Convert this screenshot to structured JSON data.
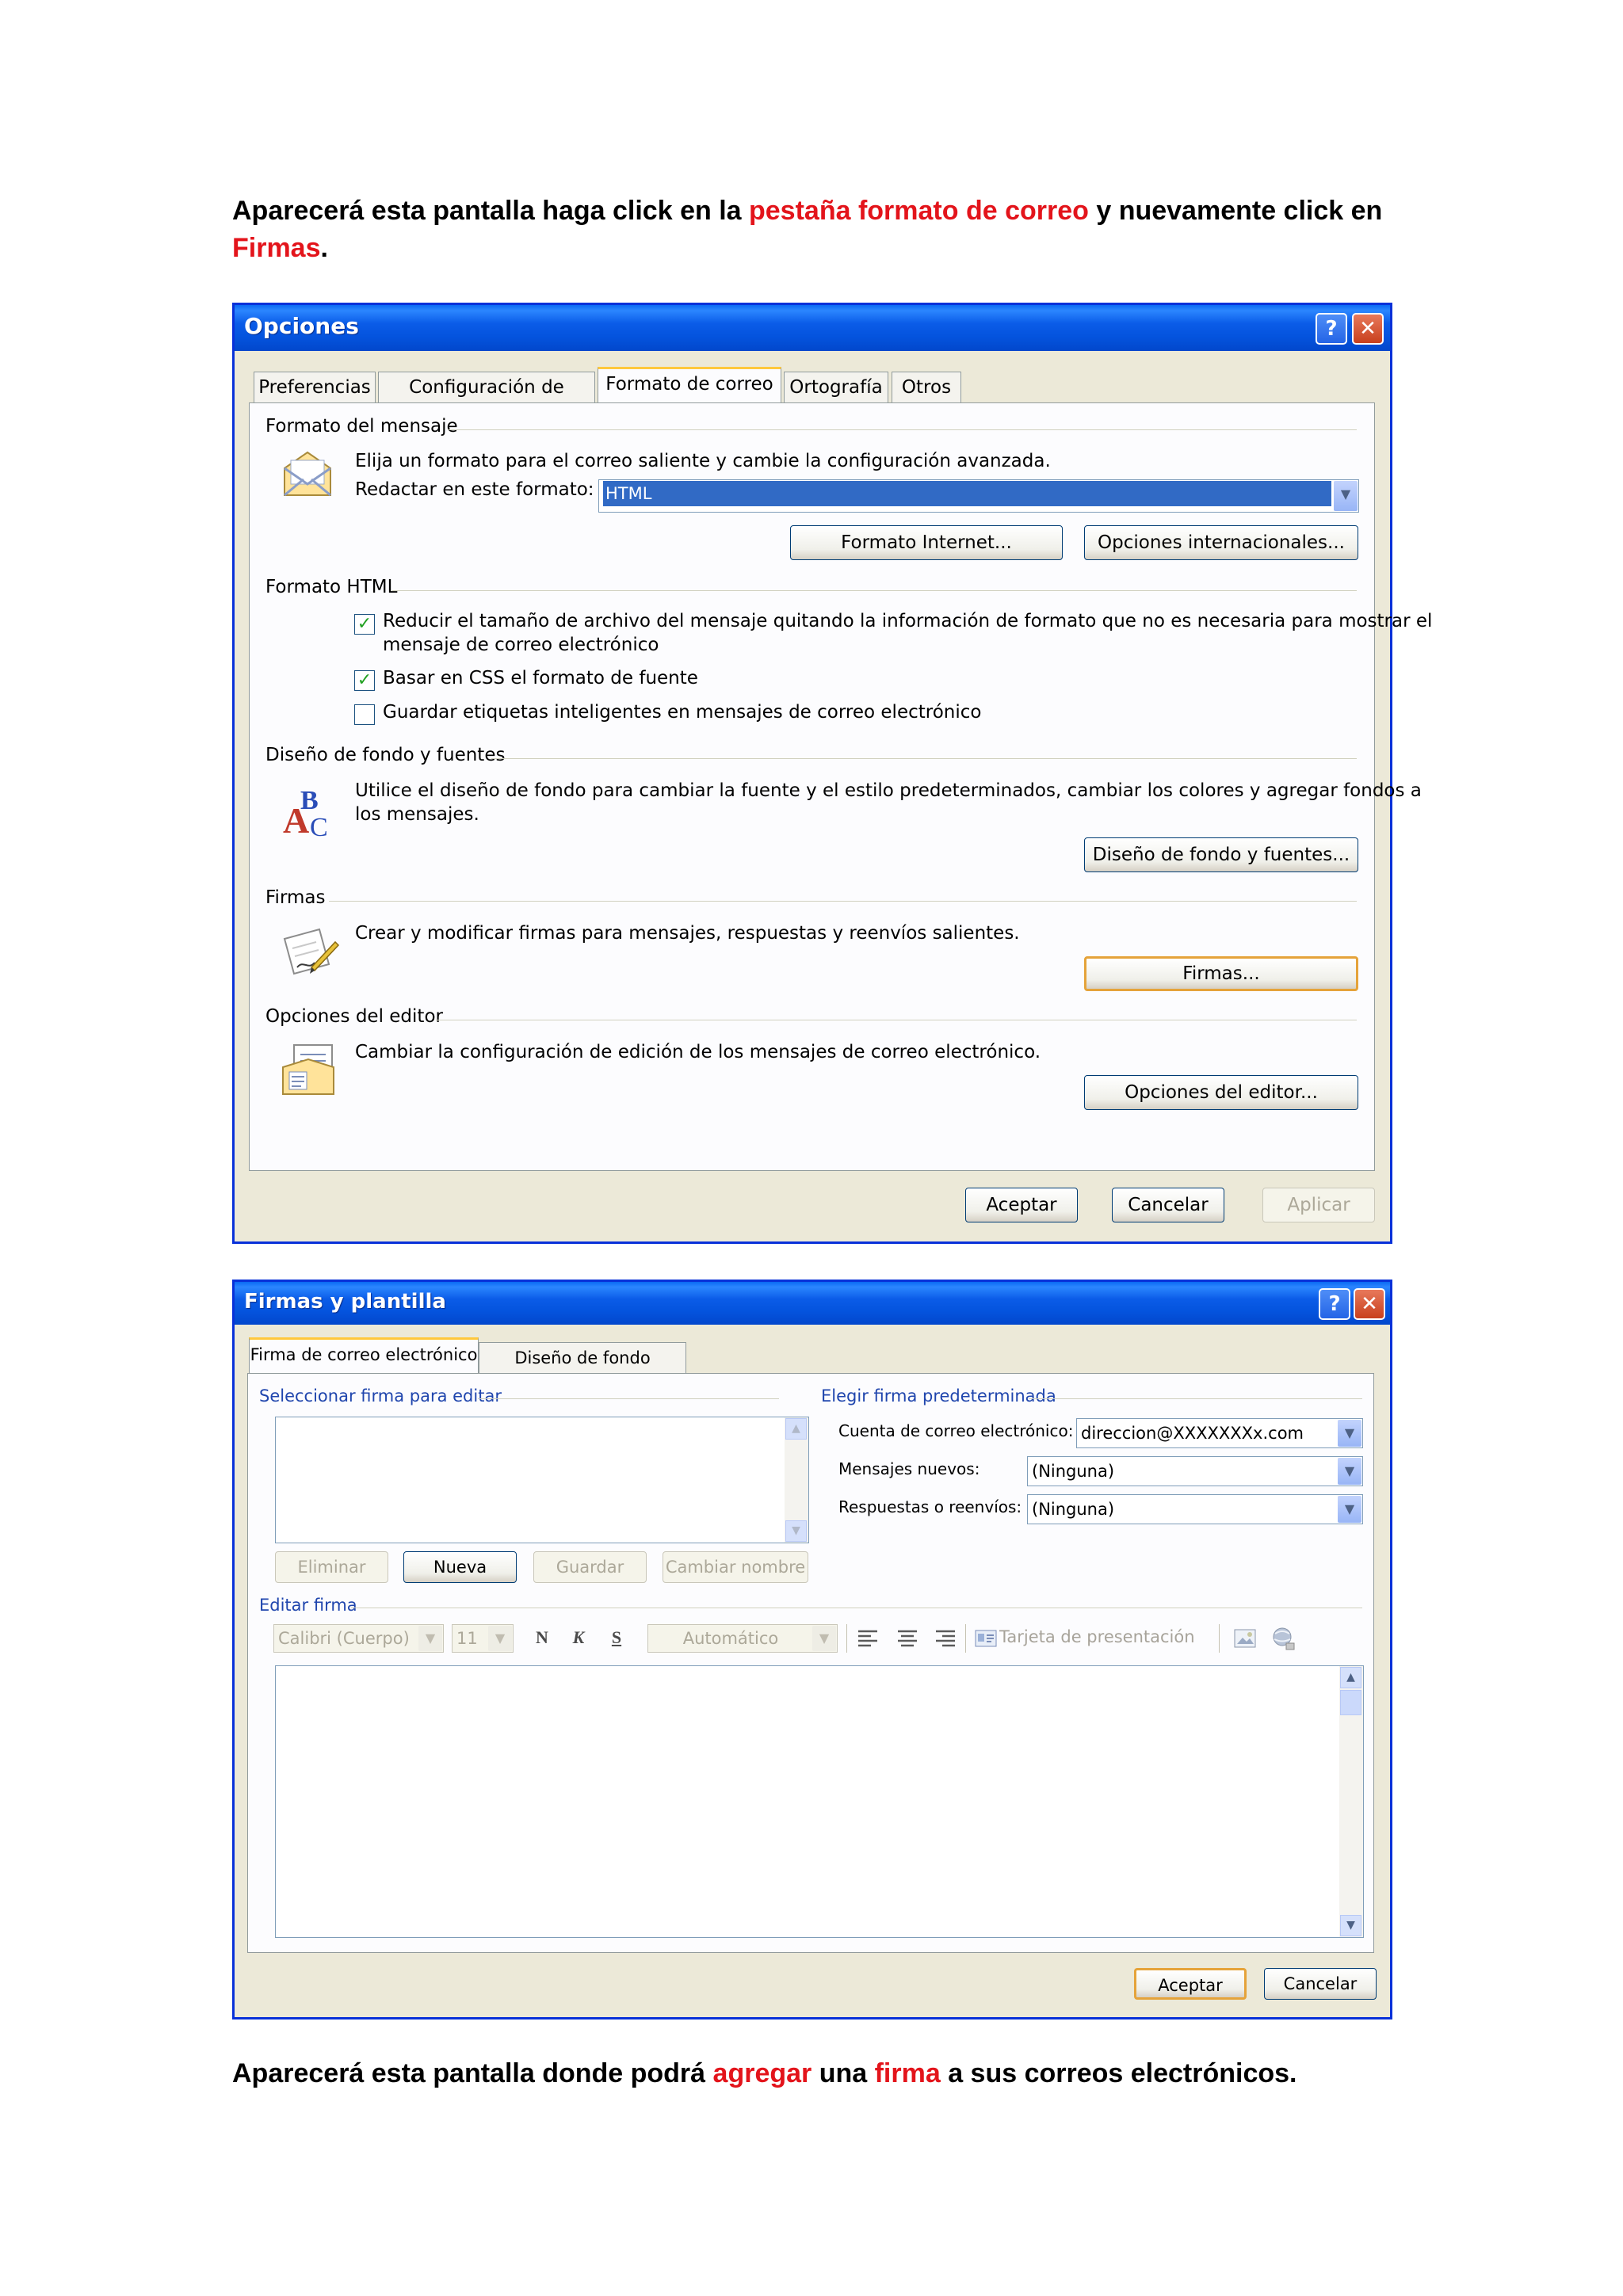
{
  "intro": {
    "part1": "Aparecerá esta pantalla haga click en la ",
    "highlight1": "pestaña formato de correo",
    "part2": " y nuevamente click en ",
    "highlight2": "Firmas",
    "part3": "."
  },
  "opciones": {
    "title": "Opciones",
    "tabs": [
      "Preferencias",
      "Configuración de correo",
      "Formato de correo",
      "Ortografía",
      "Otros"
    ],
    "formato_mensaje": {
      "heading": "Formato del mensaje",
      "description": "Elija un formato para el correo saliente y cambie la configuración avanzada.",
      "compose_label": "Redactar en este formato:",
      "compose_value": "HTML",
      "btn_internet": "Formato Internet...",
      "btn_internacional": "Opciones internacionales..."
    },
    "formato_html": {
      "heading": "Formato HTML",
      "check1_line1": "Reducir el tamaño de archivo del mensaje quitando la información de formato que no es necesaria para mostrar el",
      "check1_line2": "mensaje de correo electrónico",
      "check1_checked": true,
      "check2": "Basar en CSS el formato de fuente",
      "check2_checked": true,
      "check3": "Guardar etiquetas inteligentes en mensajes de correo electrónico",
      "check3_checked": false
    },
    "diseno": {
      "heading": "Diseño de fondo y fuentes",
      "line1": "Utilice el diseño de fondo para cambiar la fuente y el estilo predeterminados, cambiar los colores y agregar fondos a",
      "line2": "los mensajes.",
      "button": "Diseño de fondo y fuentes..."
    },
    "firmas": {
      "heading": "Firmas",
      "description": "Crear y modificar firmas para mensajes, respuestas y reenvíos salientes.",
      "button": "Firmas..."
    },
    "editor": {
      "heading": "Opciones del editor",
      "description": "Cambiar la configuración de edición de los mensajes de correo electrónico.",
      "button": "Opciones del editor..."
    },
    "footer": {
      "aceptar": "Aceptar",
      "cancelar": "Cancelar",
      "aplicar": "Aplicar"
    }
  },
  "firmas_plantilla": {
    "title": "Firmas y plantilla",
    "tabs": [
      "Firma de correo electrónico",
      "Diseño de fondo personal"
    ],
    "seleccionar_heading": "Seleccionar firma para editar",
    "elegir_heading": "Elegir firma predeterminada",
    "cuenta_label": "Cuenta de correo electrónico:",
    "cuenta_value": "direccion@XXXXXXXx.com",
    "nuevos_label": "Mensajes nuevos:",
    "nuevos_value": "(Ninguna)",
    "respuestas_label": "Respuestas o reenvíos:",
    "respuestas_value": "(Ninguna)",
    "buttons": {
      "eliminar": "Eliminar",
      "nueva": "Nueva",
      "guardar": "Guardar",
      "cambiar": "Cambiar nombre"
    },
    "editar_heading": "Editar firma",
    "toolbar": {
      "font": "Calibri (Cuerpo)",
      "size": "11",
      "bold": "N",
      "italic": "K",
      "underline": "S",
      "color": "Automático",
      "tarjeta": "Tarjeta de presentación"
    },
    "footer": {
      "aceptar": "Aceptar",
      "cancelar": "Cancelar"
    }
  },
  "outro": {
    "part1": "Aparecerá esta pantalla donde podrá ",
    "highlight1": "agregar",
    "part2": " una ",
    "highlight2": "firma",
    "part3": " a sus correos electrónicos."
  },
  "colors": {
    "highlight": "#e3141b",
    "titlebar": "#0453dd",
    "dialog_bg": "#ece9d8",
    "selection": "#316ac5"
  }
}
